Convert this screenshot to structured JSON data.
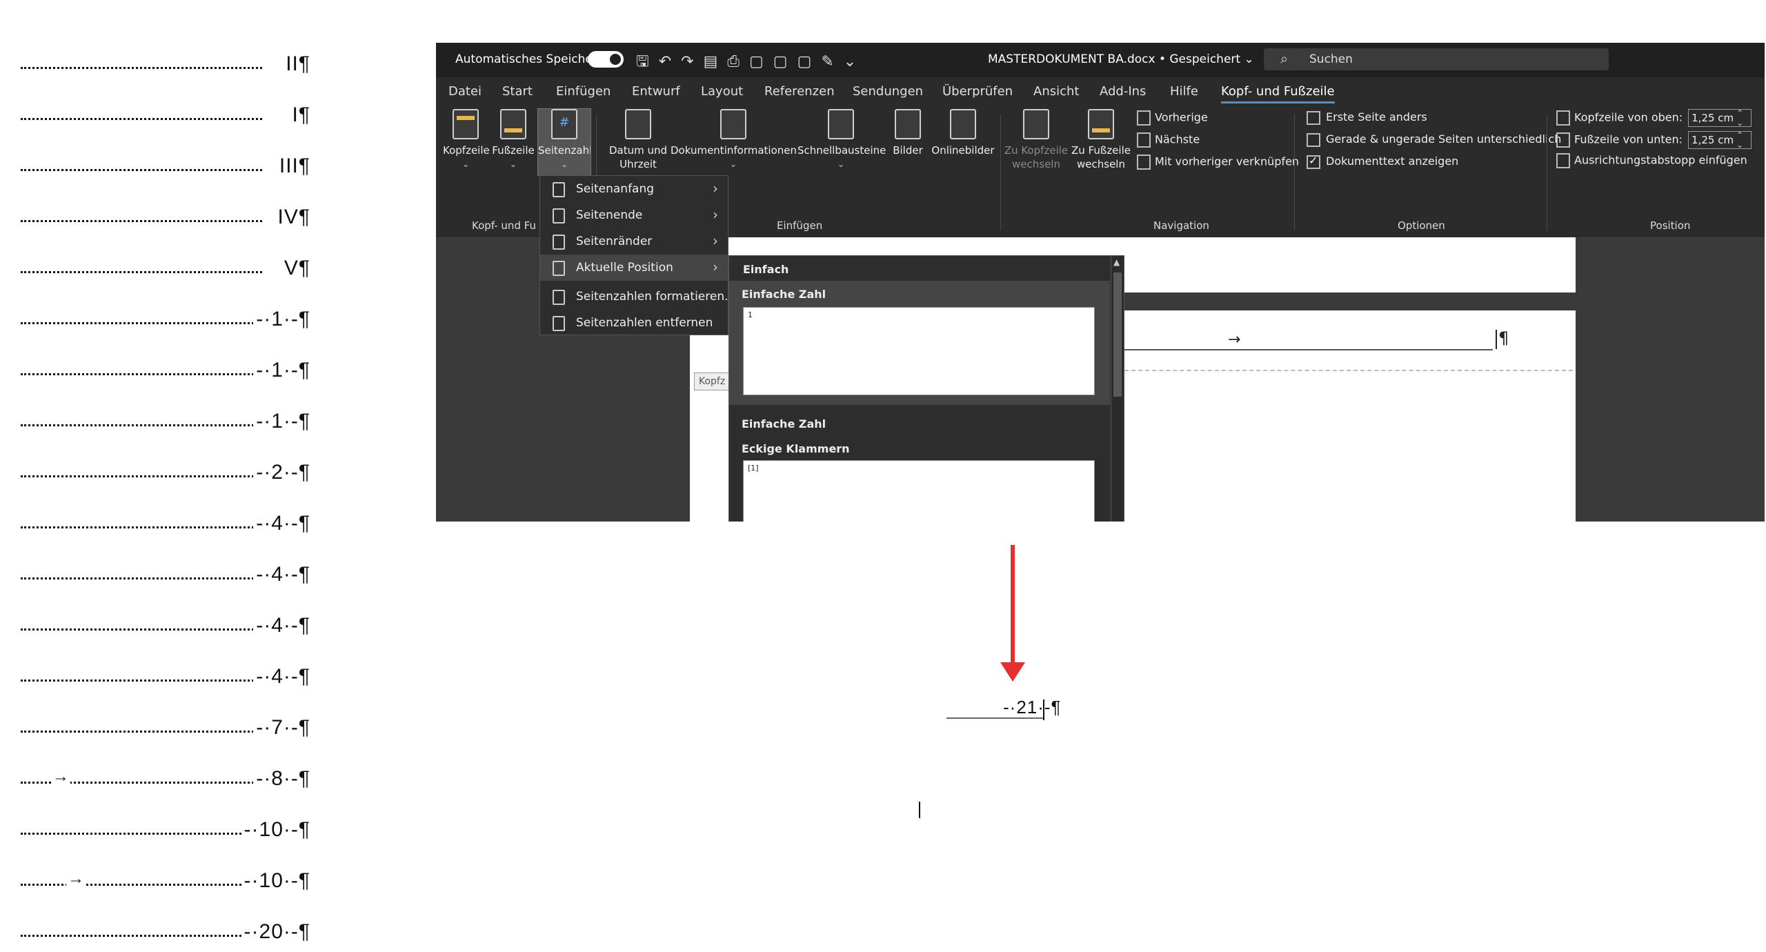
{
  "toc": [
    {
      "num": "II¶"
    },
    {
      "num": "I¶"
    },
    {
      "num": "III¶"
    },
    {
      "num": "IV¶"
    },
    {
      "num": "V¶"
    },
    {
      "num": "-·1·-¶"
    },
    {
      "num": "-·1·-¶"
    },
    {
      "num": "-·1·-¶"
    },
    {
      "num": "-·2·-¶"
    },
    {
      "num": "-·4·-¶"
    },
    {
      "num": "-·4·-¶"
    },
    {
      "num": "-·4·-¶"
    },
    {
      "num": "-·4·-¶"
    },
    {
      "num": "-·7·-¶"
    },
    {
      "num": "-·8·-¶",
      "tab_arrow": "→"
    },
    {
      "num": "-·10·-¶"
    },
    {
      "num": "-·10·-¶",
      "tab_arrow": "→"
    },
    {
      "num": "-·20·-¶"
    }
  ],
  "titlebar": {
    "autosave": "Automatisches Speichern",
    "doc_title": "MASTERDOKUMENT BA.docx • Gespeichert ⌄",
    "search_placeholder": "Suchen"
  },
  "tabs": [
    "Datei",
    "Start",
    "Einfügen",
    "Entwurf",
    "Layout",
    "Referenzen",
    "Sendungen",
    "Überprüfen",
    "Ansicht",
    "Add-Ins",
    "Hilfe",
    "Kopf- und Fußzeile"
  ],
  "ribbon": {
    "kopfzeile": "Kopfzeile",
    "fusszeile": "Fußzeile",
    "seitenzahl": "Seitenzahl",
    "datum": "Datum und Uhrzeit",
    "dokinfo": "Dokumentinformationen",
    "schnellbausteine": "Schnellbausteine",
    "bilder": "Bilder",
    "onlinebilder": "Onlinebilder",
    "zu_kopfzeile": "Zu Kopfzeile wechseln",
    "zu_fusszeile": "Zu Fußzeile wechseln",
    "vorherige": "Vorherige",
    "naechste": "Nächste",
    "verknuepfen": "Mit vorheriger verknüpfen",
    "erste_seite": "Erste Seite anders",
    "gerade": "Gerade & ungerade Seiten unterschiedlich",
    "doktext": "Dokumenttext anzeigen",
    "kopf_oben": "Kopfzeile von oben:",
    "kopf_oben_val": "1,25 cm",
    "fuss_unten": "Fußzeile von unten:",
    "fuss_unten_val": "1,25 cm",
    "ausrichtung": "Ausrichtungstabstopp einfügen",
    "group_kopf": "Kopf- und Fu",
    "group_einfuegen": "Einfügen",
    "group_navigation": "Navigation",
    "group_optionen": "Optionen",
    "group_position": "Position"
  },
  "menu": {
    "items": [
      "Seitenanfang",
      "Seitenende",
      "Seitenränder",
      "Aktuelle Position",
      "Seitenzahlen formatieren...",
      "Seitenzahlen entfernen"
    ]
  },
  "gallery": {
    "head1": "Einfach",
    "item1": "Einfache Zahl",
    "thumb1": "1",
    "item2": "Einfache Zahl",
    "item3": "Eckige Klammern",
    "thumb3": "[1]"
  },
  "page": {
    "kopfz_tag": "Kopfz",
    "arrow": "→",
    "pilcrow": "¶"
  },
  "footer": {
    "number": "-·21·-¶"
  },
  "colors": {
    "accent": "#4e8fd6",
    "annotation": "#e53030"
  }
}
